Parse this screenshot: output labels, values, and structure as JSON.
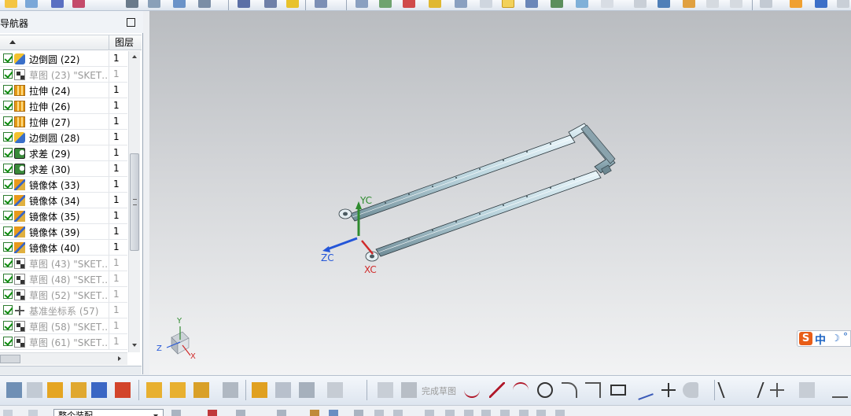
{
  "top_toolbar": {
    "icons": [
      "sketch-icon",
      "document-icon",
      "curve-icon",
      "move-icon",
      "spline-icon",
      "surface-icon",
      "view-icon",
      "layer-icon",
      "link-icon",
      "bulb-icon",
      "face-icon",
      "shaded-view-icon",
      "cube-icon",
      "render-icon",
      "background-icon",
      "studio-icon",
      "lights-icon",
      "wcs-icon",
      "snapshot-icon"
    ]
  },
  "navigator": {
    "title": "部件导航器",
    "column_layer": "图层",
    "rows": [
      {
        "name": "边倒圆 (22)",
        "layer": "1",
        "icon": "edge-blend-icon",
        "dim": false
      },
      {
        "name": "草图 (23) \"SKET…",
        "layer": "1",
        "icon": "sketch-icon",
        "dim": true
      },
      {
        "name": "拉伸 (24)",
        "layer": "1",
        "icon": "extrude-icon",
        "dim": false
      },
      {
        "name": "拉伸 (26)",
        "layer": "1",
        "icon": "extrude-icon",
        "dim": false
      },
      {
        "name": "拉伸 (27)",
        "layer": "1",
        "icon": "extrude-icon",
        "dim": false
      },
      {
        "name": "边倒圆 (28)",
        "layer": "1",
        "icon": "edge-blend-icon",
        "dim": false
      },
      {
        "name": "求差 (29)",
        "layer": "1",
        "icon": "subtract-icon",
        "dim": false
      },
      {
        "name": "求差 (30)",
        "layer": "1",
        "icon": "subtract-icon",
        "dim": false
      },
      {
        "name": "镜像体 (33)",
        "layer": "1",
        "icon": "mirror-body-icon",
        "dim": false
      },
      {
        "name": "镜像体 (34)",
        "layer": "1",
        "icon": "mirror-body-icon",
        "dim": false
      },
      {
        "name": "镜像体 (35)",
        "layer": "1",
        "icon": "mirror-body-icon",
        "dim": false
      },
      {
        "name": "镜像体 (39)",
        "layer": "1",
        "icon": "mirror-body-icon",
        "dim": false
      },
      {
        "name": "镜像体 (40)",
        "layer": "1",
        "icon": "mirror-body-icon",
        "dim": false
      },
      {
        "name": "草图 (43) \"SKET…",
        "layer": "1",
        "icon": "sketch-icon",
        "dim": true
      },
      {
        "name": "草图 (48) \"SKET…",
        "layer": "1",
        "icon": "sketch-icon",
        "dim": true
      },
      {
        "name": "草图 (52) \"SKET…",
        "layer": "1",
        "icon": "sketch-icon",
        "dim": true
      },
      {
        "name": "基准坐标系 (57)",
        "layer": "1",
        "icon": "datum-csys-icon",
        "dim": true
      },
      {
        "name": "草图 (58) \"SKET…",
        "layer": "1",
        "icon": "sketch-icon",
        "dim": true
      },
      {
        "name": "草图 (61) \"SKET…",
        "layer": "1",
        "icon": "sketch-icon",
        "dim": true
      }
    ]
  },
  "viewport": {
    "wcs_labels": {
      "yc": "YC",
      "zc": "ZC",
      "xc": "XC"
    },
    "triad_labels": {
      "y": "Y",
      "z": "Z",
      "x": "X"
    },
    "ime": {
      "logo": "S",
      "lang": "中",
      "moon": "☽",
      "dot": "°"
    }
  },
  "bottom_toolbar": {
    "finish_sketch_label": "完成草图"
  },
  "status_bar": {
    "selection_filter": "整个装配"
  }
}
